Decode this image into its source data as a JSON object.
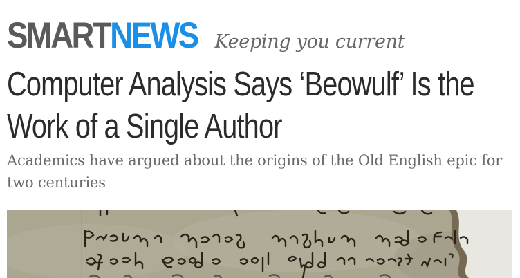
{
  "masthead": {
    "brand_smart": "SMART",
    "brand_news": "NEWS",
    "tagline": "Keeping you current"
  },
  "article": {
    "headline_line1": "Computer Analysis Says ‘Beowulf’ Is the",
    "headline_line2": "Work of a Single Author",
    "subhead": "Academics have argued about the origins of the Old English epic for two centuries"
  },
  "colors": {
    "brand_gray": "#5a5a5a",
    "brand_blue": "#1b8fe6",
    "headline": "#2b2b2b",
    "subhead": "#6a6a6a",
    "parchment": "#aaa591",
    "ink": "#2a2118"
  }
}
